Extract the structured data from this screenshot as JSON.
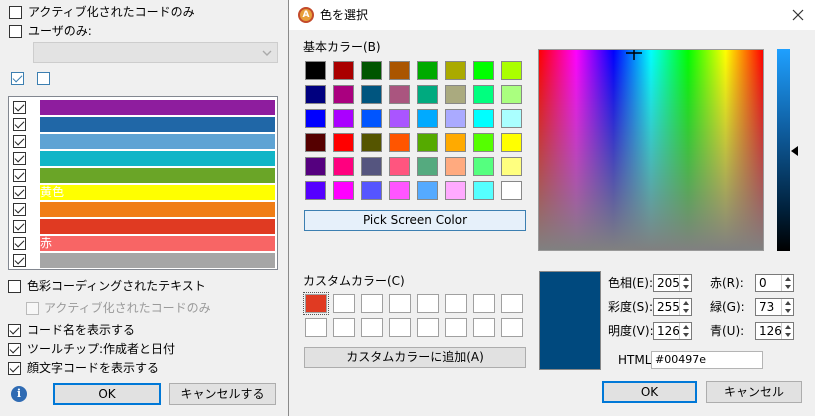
{
  "left_panel": {
    "active_codes_only": {
      "label": "アクティブ化されたコードのみ",
      "checked": false
    },
    "user_only": {
      "label": "ユーザのみ:",
      "checked": false
    },
    "user_select": {
      "value": ""
    },
    "check_all_checked": true,
    "uncheck_all_checked": false,
    "code_rows": [
      {
        "color": "#8e1d9e",
        "text": "",
        "checked": true
      },
      {
        "color": "#2067a7",
        "text": "",
        "checked": true
      },
      {
        "color": "#5ea3d4",
        "text": "",
        "checked": true
      },
      {
        "color": "#11b5c7",
        "text": "",
        "checked": true
      },
      {
        "color": "#6aa527",
        "text": "",
        "checked": true
      },
      {
        "color": "#ffff00",
        "text": "黄色",
        "checked": true
      },
      {
        "color": "#f07d16",
        "text": "",
        "checked": true
      },
      {
        "color": "#e03a22",
        "text": "",
        "checked": true
      },
      {
        "color": "#f86565",
        "text": "赤",
        "checked": true
      },
      {
        "color": "#a6a6a6",
        "text": "",
        "checked": true
      }
    ],
    "color_coded_text": {
      "label": "色彩コーディングされたテキスト",
      "checked": false
    },
    "active_codes_only_sub": {
      "label": "アクティブ化されたコードのみ",
      "checked": false
    },
    "show_code_names": {
      "label": "コード名を表示する",
      "checked": true
    },
    "tooltip_author_date": {
      "label": "ツールチップ:作成者と日付",
      "checked": true
    },
    "show_emoticon_codes": {
      "label": "顔文字コードを表示する",
      "checked": true
    },
    "info_icon": "info-icon",
    "ok_label": "OK",
    "cancel_label": "キャンセルする"
  },
  "color_dialog": {
    "title": "色を選択",
    "basic_colors_label": "基本カラー(B)",
    "basic_colors": [
      "#000000",
      "#aa0000",
      "#005500",
      "#aa5500",
      "#00aa00",
      "#aaaa00",
      "#00ff00",
      "#aaff00",
      "#00007f",
      "#aa007f",
      "#00557f",
      "#aa557f",
      "#00aa7f",
      "#aaaa7f",
      "#00ff7f",
      "#aaff7f",
      "#0000ff",
      "#aa00ff",
      "#0055ff",
      "#aa55ff",
      "#00aaff",
      "#aaaaff",
      "#00ffff",
      "#aaffff",
      "#550000",
      "#ff0000",
      "#555500",
      "#ff5500",
      "#55aa00",
      "#ffaa00",
      "#55ff00",
      "#ffff00",
      "#55007f",
      "#ff007f",
      "#55557f",
      "#ff557f",
      "#55aa7f",
      "#ffaa7f",
      "#55ff7f",
      "#ffff7f",
      "#5500ff",
      "#ff00ff",
      "#5555ff",
      "#ff55ff",
      "#55aaff",
      "#ffaaff",
      "#55ffff",
      "#ffffff"
    ],
    "pick_screen_color": "Pick Screen Color",
    "custom_colors_label": "カスタムカラー(C)",
    "custom_colors": [
      "#e03a22",
      "",
      "",
      "",
      "",
      "",
      "",
      "",
      "",
      "",
      "",
      "",
      "",
      "",
      "",
      ""
    ],
    "add_custom_color": "カスタムカラーに追加(A)",
    "current_color": "#00497e",
    "hue_label": "色相(E):",
    "hue": "205",
    "sat_label": "彩度(S):",
    "sat": "255",
    "val_label": "明度(V):",
    "val": "126",
    "red_label": "赤(R):",
    "red": "0",
    "green_label": "緑(G):",
    "green": "73",
    "blue_label": "青(U):",
    "blue": "126",
    "html_label": "HTML:",
    "html": "#00497e",
    "ok_label": "OK",
    "cancel_label": "キャンセル",
    "close_icon": "close-icon",
    "app_icon": "app-logo-icon"
  }
}
